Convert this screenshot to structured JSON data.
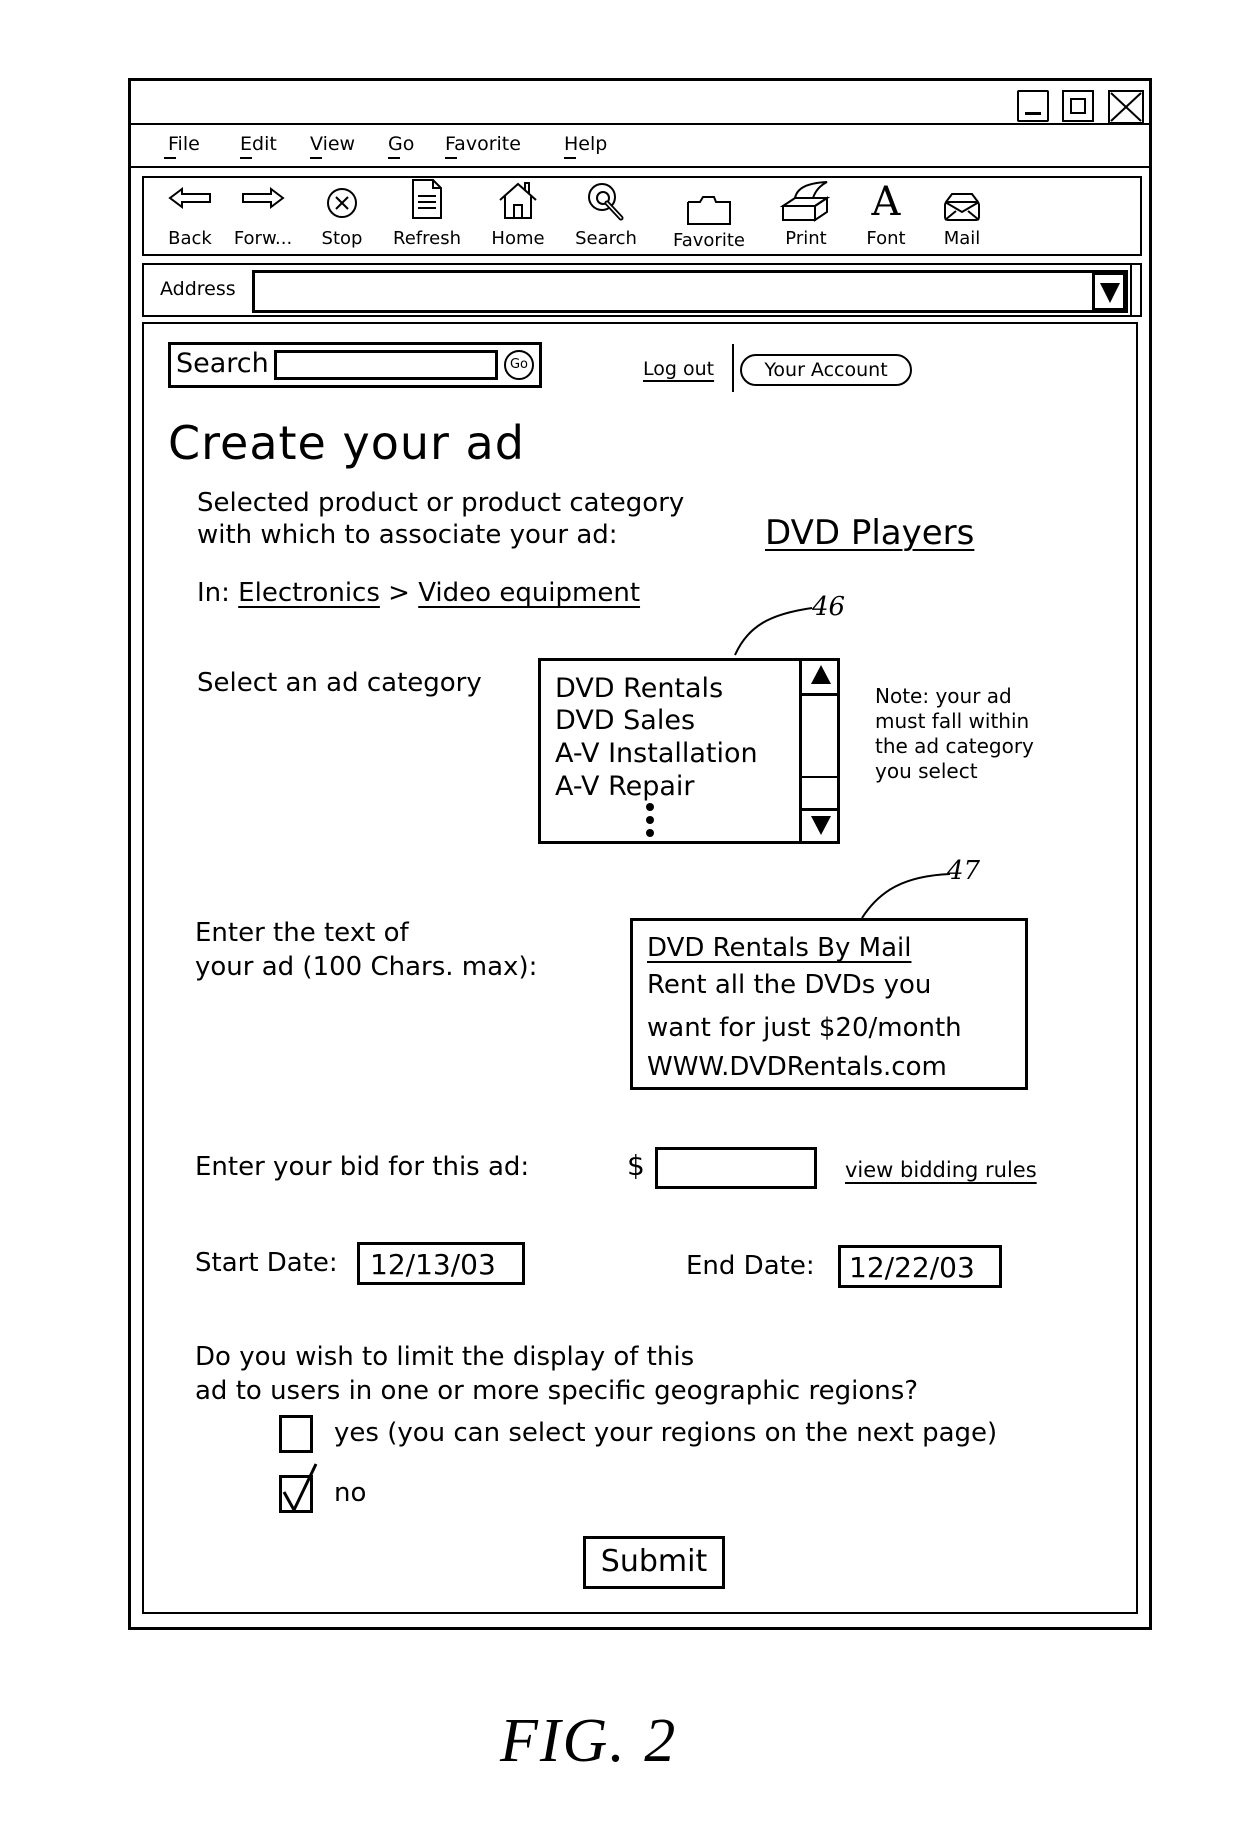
{
  "window": {
    "controls": {
      "minimize_icon": "minimize-icon",
      "maximize_icon": "maximize-icon",
      "close_icon": "close-icon"
    }
  },
  "menu": {
    "items": [
      {
        "label": "File",
        "mnemonic": "F"
      },
      {
        "label": "Edit",
        "mnemonic": "E"
      },
      {
        "label": "View",
        "mnemonic": "V"
      },
      {
        "label": "Go",
        "mnemonic": "G"
      },
      {
        "label": "Favorite",
        "mnemonic": "F"
      },
      {
        "label": "Help",
        "mnemonic": "H"
      }
    ]
  },
  "toolbar": {
    "buttons": [
      {
        "label": "Back",
        "icon": "back-arrow-icon"
      },
      {
        "label": "Forw...",
        "icon": "forward-arrow-icon"
      },
      {
        "label": "Stop",
        "icon": "stop-icon"
      },
      {
        "label": "Refresh",
        "icon": "document-icon"
      },
      {
        "label": "Home",
        "icon": "home-icon"
      },
      {
        "label": "Search",
        "icon": "magnifier-icon"
      },
      {
        "label": "Favorite",
        "icon": "folder-icon"
      },
      {
        "label": "Print",
        "icon": "printer-icon"
      },
      {
        "label": "Font",
        "icon": "font-icon"
      },
      {
        "label": "Mail",
        "icon": "envelope-icon"
      }
    ]
  },
  "address": {
    "label": "Address",
    "value": "",
    "dropdown_icon": "dropdown-arrow-icon"
  },
  "page": {
    "search": {
      "label": "Search",
      "value": "",
      "go_label": "Go"
    },
    "logout_label": "Log out",
    "account_label": "Your Account",
    "title": "Create your ad",
    "selected_product": {
      "label_line1": "Selected product or product category",
      "label_line2": "with which to associate your ad:",
      "value": "DVD Players"
    },
    "breadcrumb": {
      "prefix": "In:",
      "items": [
        "Electronics",
        "Video equipment"
      ],
      "separator": ">"
    },
    "ad_category": {
      "label": "Select an ad category",
      "options": [
        "DVD Rentals",
        "DVD Sales",
        "A-V Installation",
        "A-V Repair"
      ],
      "more_indicator": "⋮",
      "reference_numeral": "46",
      "note_lines": [
        "Note: your ad",
        "must fall within",
        "the ad category",
        "you select"
      ]
    },
    "ad_text": {
      "label_line1": "Enter the text of",
      "label_line2": "your ad (100 Chars. max):",
      "headline": "DVD Rentals By Mail",
      "body_line1": "Rent all the DVDs you",
      "body_line2": "want for just $20/month",
      "url_line": "WWW.DVDRentals.com",
      "reference_numeral": "47"
    },
    "bid": {
      "label": "Enter your bid for this ad:",
      "currency": "$",
      "value": "",
      "rules_link": "view bidding rules"
    },
    "dates": {
      "start_label": "Start Date:",
      "start_value": "12/13/03",
      "end_label": "End Date:",
      "end_value": "12/22/03"
    },
    "geo": {
      "question_line1": "Do you wish to limit the display of this",
      "question_line2": "ad to users in one or more specific geographic regions?",
      "options": [
        {
          "label": "yes (you can select your regions on the next page)",
          "checked": false
        },
        {
          "label": "no",
          "checked": true
        }
      ]
    },
    "submit_label": "Submit"
  },
  "figure_caption": "FIG. 2"
}
